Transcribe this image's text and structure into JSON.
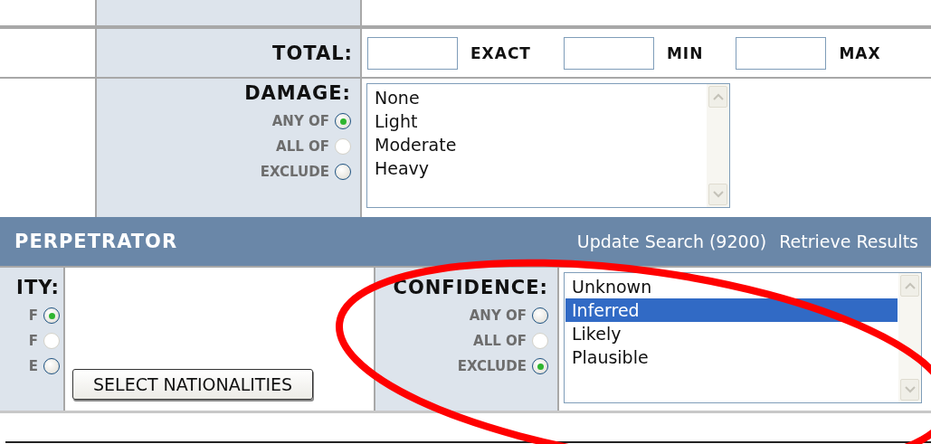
{
  "total": {
    "label": "TOTAL:",
    "fields": [
      {
        "label": "EXACT"
      },
      {
        "label": "MIN"
      },
      {
        "label": "MAX"
      }
    ]
  },
  "damage": {
    "label": "DAMAGE:",
    "modes": [
      {
        "label": "ANY OF",
        "selected": true,
        "disabled": false
      },
      {
        "label": "ALL OF",
        "selected": false,
        "disabled": true
      },
      {
        "label": "EXCLUDE",
        "selected": false,
        "disabled": false
      }
    ],
    "options": [
      {
        "label": "None",
        "selected": false
      },
      {
        "label": "Light",
        "selected": false
      },
      {
        "label": "Moderate",
        "selected": false
      },
      {
        "label": "Heavy",
        "selected": false
      }
    ]
  },
  "section_header": {
    "title": "PERPETRATOR",
    "links": [
      "Update Search (9200)",
      "Retrieve Results"
    ]
  },
  "nationality": {
    "label": "ITY:",
    "modes": [
      {
        "label": "F",
        "selected": true,
        "disabled": false
      },
      {
        "label": "F",
        "selected": false,
        "disabled": true
      },
      {
        "label": "E",
        "selected": false,
        "disabled": false
      }
    ],
    "button": "SELECT NATIONALITIES"
  },
  "confidence": {
    "label": "CONFIDENCE:",
    "modes": [
      {
        "label": "ANY OF",
        "selected": false,
        "disabled": false
      },
      {
        "label": "ALL OF",
        "selected": false,
        "disabled": true
      },
      {
        "label": "EXCLUDE",
        "selected": true,
        "disabled": false
      }
    ],
    "options": [
      {
        "label": "Unknown",
        "selected": false
      },
      {
        "label": "Inferred",
        "selected": true
      },
      {
        "label": "Likely",
        "selected": false
      },
      {
        "label": "Plausible",
        "selected": false
      }
    ]
  }
}
